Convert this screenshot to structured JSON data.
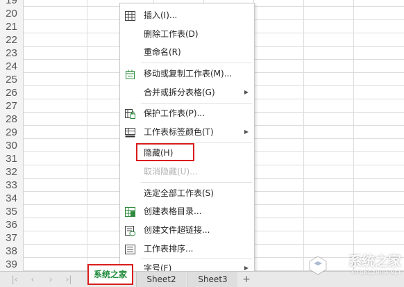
{
  "rows": [
    "19",
    "20",
    "21",
    "22",
    "23",
    "24",
    "25",
    "26",
    "27",
    "28",
    "29",
    "30",
    "31",
    "32",
    "33",
    "34",
    "35",
    "36",
    "37",
    "38",
    "39"
  ],
  "context_menu": {
    "items": [
      {
        "name": "insert",
        "label": "插入(I)...",
        "icon": "insert-table-icon",
        "enabled": true,
        "submenu": false
      },
      {
        "name": "delete-sheet",
        "label": "删除工作表(D)",
        "icon": "",
        "enabled": true,
        "submenu": false
      },
      {
        "name": "rename",
        "label": "重命名(R)",
        "icon": "",
        "enabled": true,
        "submenu": false
      },
      {
        "name": "move-copy-sheet",
        "label": "移动或复制工作表(M)...",
        "icon": "move-copy-icon",
        "enabled": true,
        "submenu": false
      },
      {
        "name": "merge-split-table",
        "label": "合并或拆分表格(G)",
        "icon": "",
        "enabled": true,
        "submenu": true
      },
      {
        "name": "protect-sheet",
        "label": "保护工作表(P)...",
        "icon": "protect-sheet-icon",
        "enabled": true,
        "submenu": false
      },
      {
        "name": "tab-color",
        "label": "工作表标签颜色(T)",
        "icon": "tab-color-icon",
        "enabled": true,
        "submenu": true
      },
      {
        "name": "hide",
        "label": "隐藏(H)",
        "icon": "",
        "enabled": true,
        "submenu": false
      },
      {
        "name": "unhide",
        "label": "取消隐藏(U)...",
        "icon": "",
        "enabled": false,
        "submenu": false
      },
      {
        "name": "select-all-sheets",
        "label": "选定全部工作表(S)",
        "icon": "",
        "enabled": true,
        "submenu": false
      },
      {
        "name": "create-table-index",
        "label": "创建表格目录...",
        "icon": "table-index-icon",
        "enabled": true,
        "submenu": false
      },
      {
        "name": "create-file-hyperlink",
        "label": "创建文件超链接...",
        "icon": "file-link-icon",
        "enabled": true,
        "submenu": false
      },
      {
        "name": "sort-sheets",
        "label": "工作表排序...",
        "icon": "sort-list-icon",
        "enabled": true,
        "submenu": false
      },
      {
        "name": "font-size",
        "label": "字号(F)",
        "icon": "",
        "enabled": true,
        "submenu": true
      }
    ]
  },
  "tabs": [
    {
      "label": "系统之家",
      "active": true
    },
    {
      "label": "Sheet2",
      "active": false
    },
    {
      "label": "Sheet3",
      "active": false
    }
  ],
  "add_sheet_label": "+",
  "watermark": {
    "cn": "系统之家",
    "en": "XITONGZHIJIA.NET"
  },
  "colors": {
    "highlight": "#d91c1c",
    "active_tab_text": "#1f8a3a",
    "icon_green": "#2e8b3e"
  }
}
